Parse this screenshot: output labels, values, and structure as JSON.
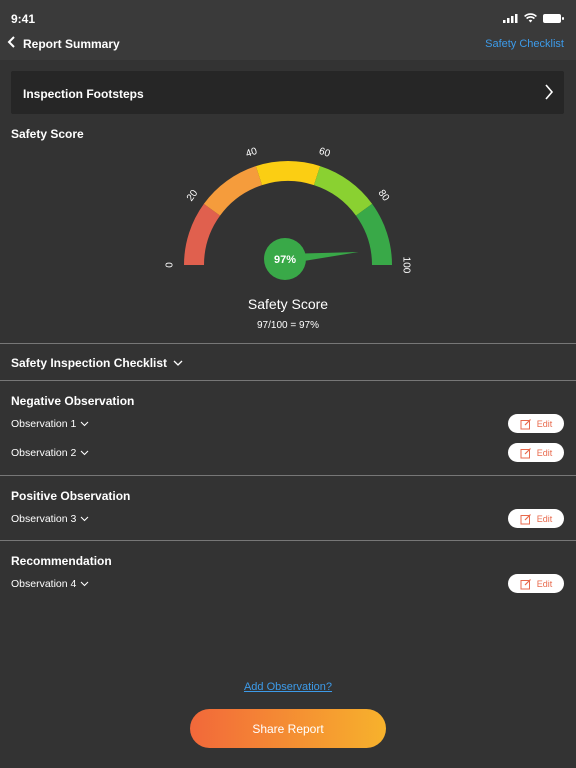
{
  "status": {
    "time": "9:41"
  },
  "nav": {
    "title": "Report Summary",
    "right_link": "Safety Checklist"
  },
  "card": {
    "title": "Inspection Footsteps"
  },
  "safety": {
    "section_title": "Safety Score",
    "gauge_labels": [
      "0",
      "20",
      "40",
      "60",
      "80",
      "100"
    ],
    "value_percent": 97,
    "value_label": "97%",
    "caption_title": "Safety Score",
    "caption_equation": "97/100 = 97%",
    "colors": [
      "#e0604e",
      "#f59c3c",
      "#fbce13",
      "#8ad131",
      "#39a948"
    ]
  },
  "checklist": {
    "title": "Safety Inspection Checklist"
  },
  "negative": {
    "title": "Negative Observation",
    "items": [
      "Observation 1",
      "Observation 2"
    ]
  },
  "positive": {
    "title": "Positive Observation",
    "items": [
      "Observation 3"
    ]
  },
  "recommendation": {
    "title": "Recommendation",
    "items": [
      "Observation 4"
    ]
  },
  "edit_label": "Edit",
  "add_observation": "Add Observation?",
  "share_button": "Share Report"
}
